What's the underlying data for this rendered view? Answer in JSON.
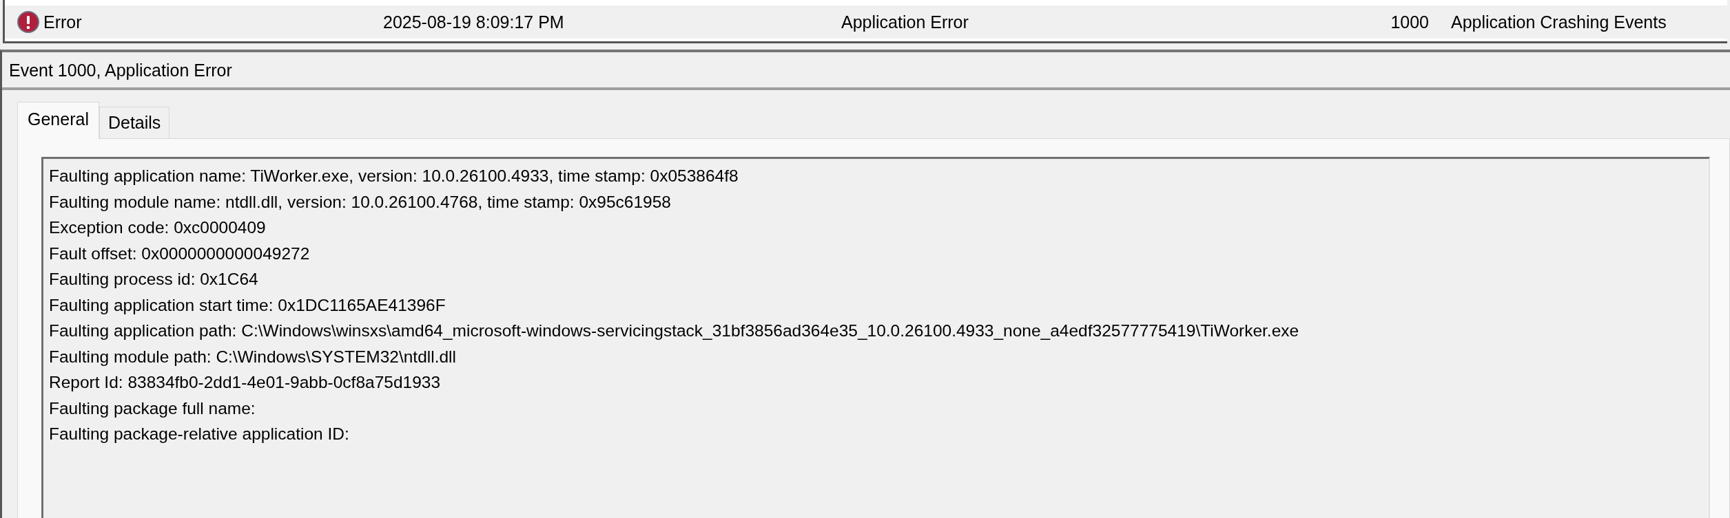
{
  "event_list": {
    "rows": [
      {
        "level": "Error",
        "date_time": "2025-08-19 8:09:17 PM",
        "source": "Application Error",
        "event_id": "1000",
        "task_category": "Application Crashing Events",
        "selected": true
      }
    ]
  },
  "details_pane": {
    "title": "Event 1000, Application Error",
    "tabs": [
      {
        "label": "General",
        "selected": true
      },
      {
        "label": "Details",
        "selected": false
      }
    ],
    "description_lines": [
      "Faulting application name: TiWorker.exe, version: 10.0.26100.4933, time stamp: 0x053864f8",
      "Faulting module name: ntdll.dll, version: 10.0.26100.4768, time stamp: 0x95c61958",
      "Exception code: 0xc0000409",
      "Fault offset: 0x0000000000049272",
      "Faulting process id: 0x1C64",
      "Faulting application start time: 0x1DC1165AE41396F",
      "Faulting application path: C:\\Windows\\winsxs\\amd64_microsoft-windows-servicingstack_31bf3856ad364e35_10.0.26100.4933_none_a4edf32577775419\\TiWorker.exe",
      "Faulting module path: C:\\Windows\\SYSTEM32\\ntdll.dll",
      "Report Id: 83834fb0-2dd1-4e01-9abb-0cf8a75d1933",
      "Faulting package full name:",
      "Faulting package-relative application ID:"
    ]
  }
}
